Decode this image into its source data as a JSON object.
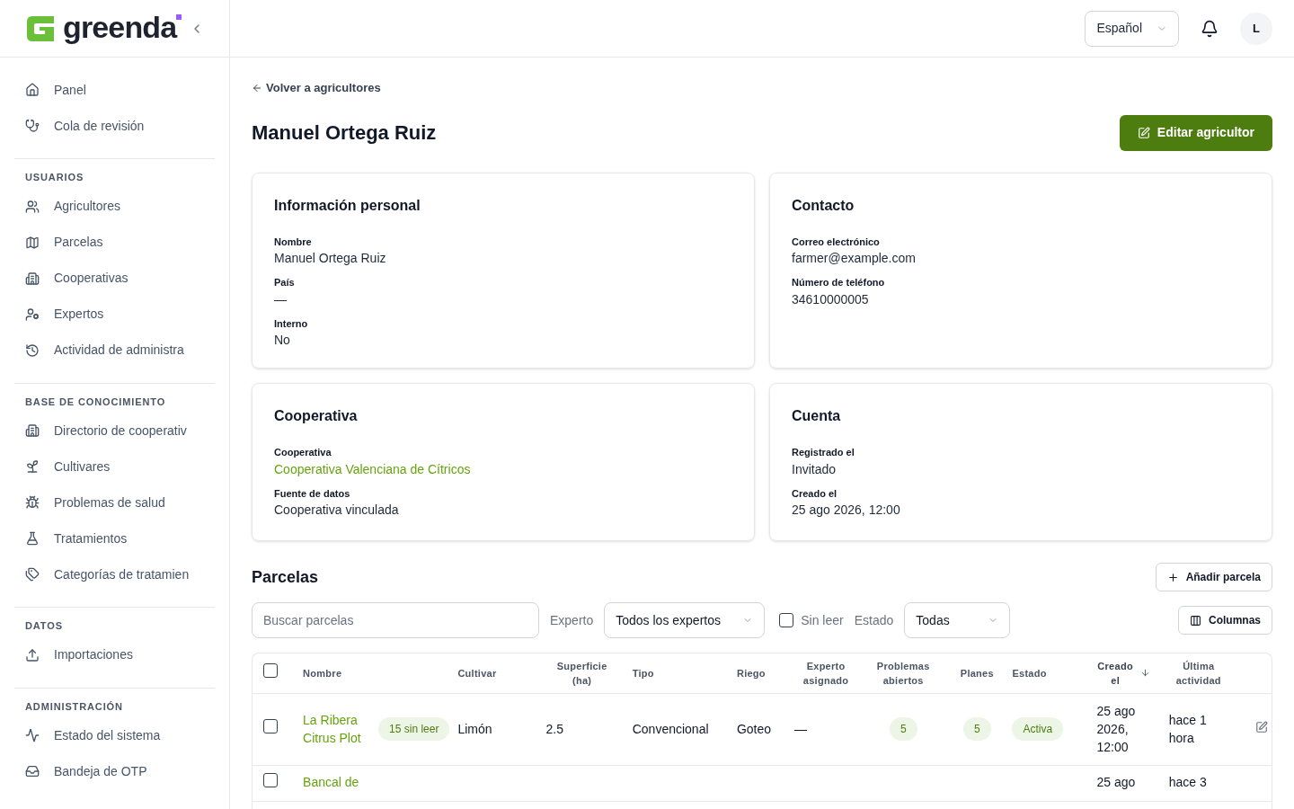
{
  "sidebar": {
    "brand": "greenda",
    "sections": [
      {
        "items": [
          {
            "label": "Panel",
            "selected": false
          },
          {
            "label": "Cola de revisión",
            "selected": false
          }
        ]
      },
      {
        "title": "USUARIOS",
        "items": [
          {
            "label": "Agricultores",
            "selected": false
          },
          {
            "label": "Parcelas",
            "selected": false
          },
          {
            "label": "Cooperativas",
            "selected": false
          },
          {
            "label": "Expertos",
            "selected": false
          },
          {
            "label": "Actividad de administra",
            "selected": false
          }
        ]
      },
      {
        "title": "BASE DE CONOCIMIENTO",
        "items": [
          {
            "label": "Directorio de cooperativ",
            "selected": false
          },
          {
            "label": "Cultivares",
            "selected": false
          },
          {
            "label": "Problemas de salud",
            "selected": false
          },
          {
            "label": "Tratamientos",
            "selected": false
          },
          {
            "label": "Categorías de tratamien",
            "selected": false
          }
        ]
      },
      {
        "title": "DATOS",
        "items": [
          {
            "label": "Importaciones",
            "selected": false
          }
        ]
      },
      {
        "title": "ADMINISTRACIÓN",
        "items": [
          {
            "label": "Estado del sistema",
            "selected": false
          },
          {
            "label": "Bandeja de OTP",
            "selected": false
          }
        ]
      }
    ]
  },
  "topbar": {
    "language": "Español",
    "avatar": "L"
  },
  "back_link": "Volver a agricultores",
  "title": "Manuel Ortega Ruiz",
  "edit_button": "Editar agricultor",
  "cards": [
    {
      "title": "Información personal",
      "fields": [
        {
          "label": "Nombre",
          "value": "Manuel Ortega Ruiz",
          "kind": "text"
        },
        {
          "label": "País",
          "value": "—",
          "kind": "text"
        },
        {
          "label": "Interno",
          "value": "No",
          "kind": "text"
        }
      ]
    },
    {
      "title": "Contacto",
      "fields": [
        {
          "label": "Correo electrónico",
          "value": "farmer@example.com",
          "kind": "text"
        },
        {
          "label": "Número de teléfono",
          "value": "34610000005",
          "kind": "text"
        }
      ]
    },
    {
      "title": "Cooperativa",
      "fields": [
        {
          "label": "Cooperativa",
          "value": "Cooperativa Valenciana de Cítricos",
          "kind": "link"
        },
        {
          "label": "Fuente de datos",
          "value": "Cooperativa vinculada",
          "kind": "text"
        }
      ]
    },
    {
      "title": "Cuenta",
      "fields": [
        {
          "label": "Registrado el",
          "value": "Invitado",
          "kind": "text"
        },
        {
          "label": "Creado el",
          "value": "25 ago 2026, 12:00",
          "kind": "text"
        }
      ]
    }
  ],
  "plots": {
    "title": "Parcelas",
    "add_button": "Añadir parcela",
    "search": {
      "placeholder": "Buscar parcelas"
    },
    "expert_label": "Experto",
    "expert_select": "Todos los expertos",
    "unread": {
      "label": "Sin leer",
      "checked": false
    },
    "status_label": "Estado",
    "status_select": "Todas",
    "columns_button": "Columnas",
    "select_all": {
      "checked": false
    },
    "columns": [
      {
        "label": "Nombre",
        "sorted": false
      },
      {
        "label": "Cultivar",
        "sorted": false
      },
      {
        "label": "Superficie (ha)",
        "sorted": false
      },
      {
        "label": "Tipo",
        "sorted": false
      },
      {
        "label": "Riego",
        "sorted": false
      },
      {
        "label": "Experto asignado",
        "sorted": false
      },
      {
        "label": "Problemas abiertos",
        "sorted": false
      },
      {
        "label": "Planes",
        "sorted": false
      },
      {
        "label": "Estado",
        "sorted": false
      },
      {
        "label": "Creado el",
        "sorted": true
      },
      {
        "label": "Última actividad",
        "sorted": false
      }
    ],
    "rows": [
      {
        "checked": false,
        "name": "La Ribera Citrus Plot",
        "unread": "15 sin leer",
        "cultivar": "Limón",
        "area": "2.5",
        "type": "Convencional",
        "irrigation": "Goteo",
        "expert": "—",
        "problems": "5",
        "plans": "5",
        "status": "Activa",
        "created": "25 ago 2026, 12:00",
        "last_activity": "hace 1 hora"
      },
      {
        "checked": false,
        "name": "Bancal de",
        "created": "25 ago",
        "last_activity": "hace 3"
      }
    ]
  }
}
